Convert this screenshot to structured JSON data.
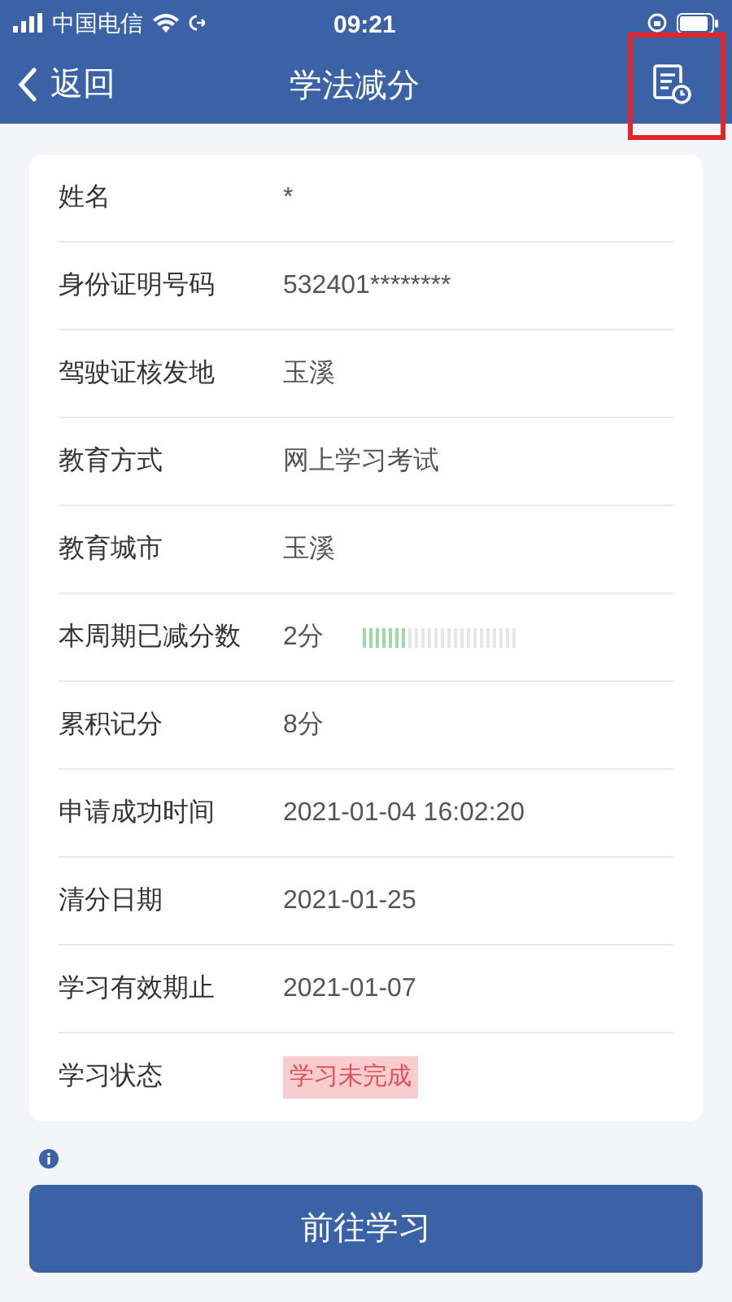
{
  "status_bar": {
    "carrier": "中国电信",
    "time": "09:21"
  },
  "nav": {
    "back": "返回",
    "title": "学法减分"
  },
  "rows": [
    {
      "kind": "text",
      "label": "姓名",
      "value": "*"
    },
    {
      "kind": "text",
      "label": "身份证明号码",
      "value": "532401********"
    },
    {
      "kind": "text",
      "label": "驾驶证核发地",
      "value": "玉溪"
    },
    {
      "kind": "text",
      "label": "教育方式",
      "value": "网上学习考试"
    },
    {
      "kind": "text",
      "label": "教育城市",
      "value": "玉溪"
    },
    {
      "kind": "meter",
      "label": "本周期已减分数",
      "value": "2分",
      "level": 0.29
    },
    {
      "kind": "text",
      "label": "累积记分",
      "value": "8分"
    },
    {
      "kind": "text",
      "label": "申请成功时间",
      "value": "2021-01-04 16:02:20"
    },
    {
      "kind": "text",
      "label": "清分日期",
      "value": "2021-01-25"
    },
    {
      "kind": "text",
      "label": "学习有效期止",
      "value": "2021-01-07"
    },
    {
      "kind": "badge",
      "label": "学习状态",
      "value": "学习未完成"
    }
  ],
  "button": "前往学习"
}
